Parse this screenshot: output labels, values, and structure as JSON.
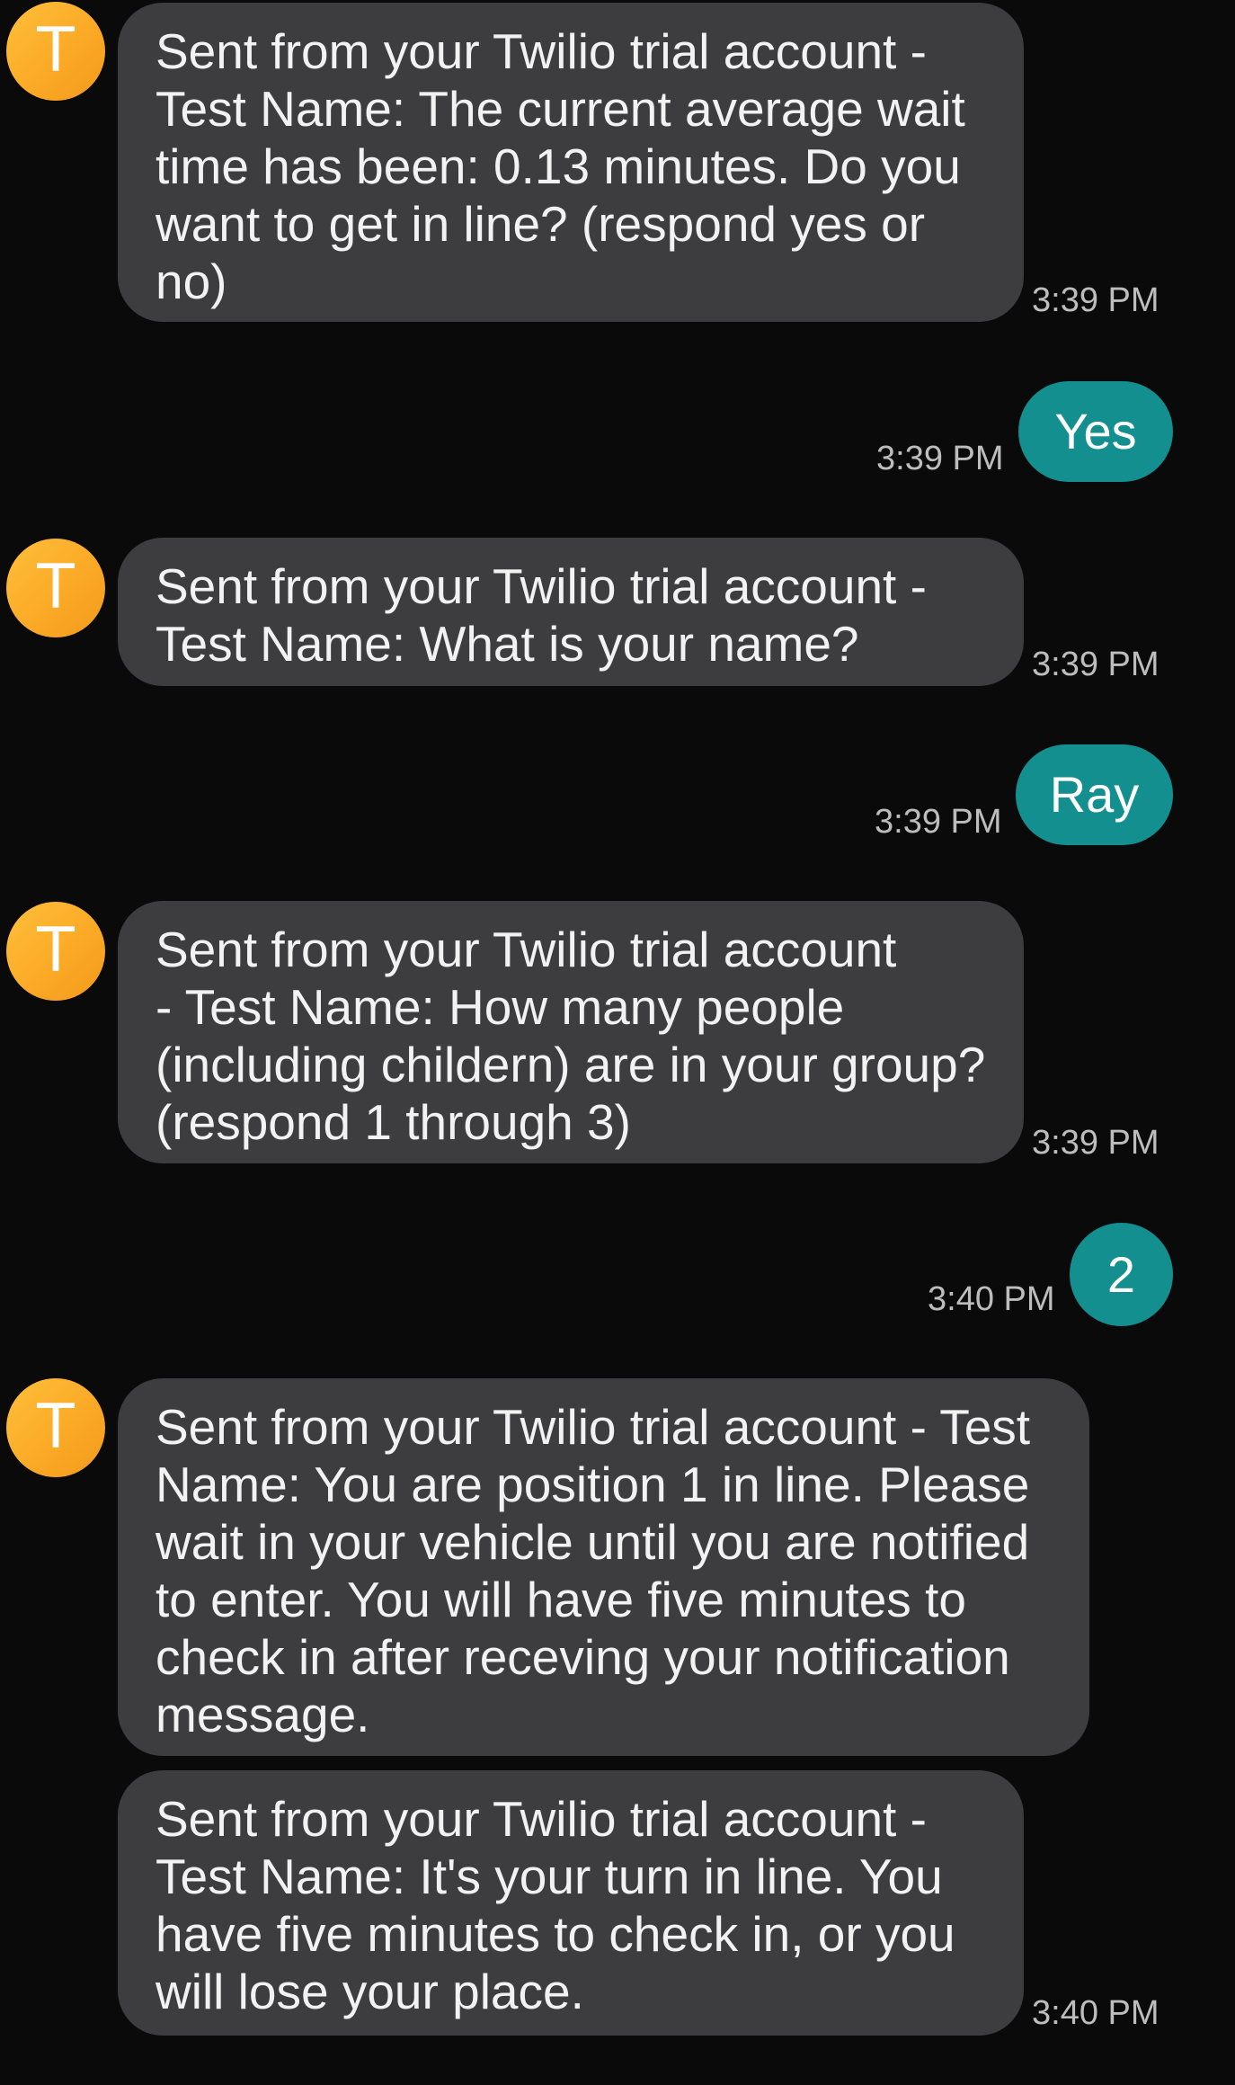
{
  "conversation": {
    "messages": [
      {
        "direction": "incoming",
        "avatar_letter": "T",
        "text": "Sent from your Twilio trial account -\nTest Name: The current average wait\ntime has been: 0.13 minutes. Do you\nwant to get in line? (respond yes or\nno)",
        "time": "3:39 PM"
      },
      {
        "direction": "outgoing",
        "text": "Yes",
        "time": "3:39 PM"
      },
      {
        "direction": "incoming",
        "avatar_letter": "T",
        "text": "Sent from your Twilio trial account -\nTest Name: What is your name?",
        "time": "3:39 PM"
      },
      {
        "direction": "outgoing",
        "text": "Ray",
        "time": "3:39 PM"
      },
      {
        "direction": "incoming",
        "avatar_letter": "T",
        "text": "Sent from your Twilio trial account\n- Test Name: How many people\n(including childern) are in your group?\n(respond 1 through 3)",
        "time": "3:39 PM"
      },
      {
        "direction": "outgoing",
        "text": "2",
        "time": "3:40 PM"
      },
      {
        "direction": "incoming",
        "avatar_letter": "T",
        "text": "Sent from your Twilio trial account - Test\nName: You are position 1 in line. Please\nwait in your vehicle until you are notified\nto enter. You will have five minutes to\ncheck in after receving your notification\nmessage.",
        "time": ""
      },
      {
        "direction": "incoming",
        "avatar_letter": "",
        "text": "Sent from your Twilio trial account -\nTest Name: It's your turn in line. You\nhave five minutes to check in, or you\nwill lose your place.",
        "time": "3:40 PM"
      }
    ]
  },
  "colors": {
    "background": "#0a0a0b",
    "incoming_bubble": "#3d3d3f",
    "outgoing_bubble": "#138f8f",
    "avatar": "#fbaa26",
    "timestamp": "#bdbdbd"
  }
}
